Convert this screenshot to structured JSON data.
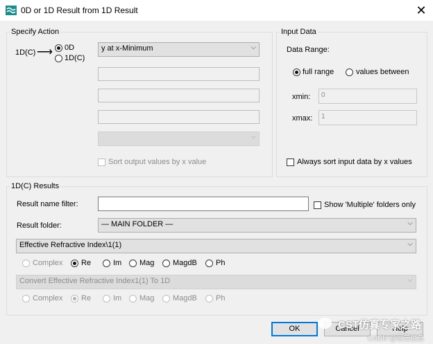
{
  "window": {
    "title": "0D or 1D Result from 1D Result",
    "app_icon": "wave-icon",
    "close_icon": "close-icon"
  },
  "specify_action": {
    "legend": "Specify Action",
    "source_label": "1D(C)",
    "options": [
      {
        "label": "0D",
        "selected": true
      },
      {
        "label": "1D(C)",
        "selected": false
      }
    ],
    "operation_value": "y at x-Minimum",
    "sort_output_label": "Sort output values by x value"
  },
  "input_data": {
    "legend": "Input Data",
    "data_range_label": "Data Range:",
    "range_options": [
      {
        "label": "full range",
        "selected": true
      },
      {
        "label": "values between",
        "selected": false
      }
    ],
    "xmin_label": "xmin:",
    "xmin_value": "0",
    "xmax_label": "xmax:",
    "xmax_value": "1",
    "always_sort_label": "Always sort input data by x values"
  },
  "results": {
    "legend": "1D(C) Results",
    "name_filter_label": "Result name filter:",
    "name_filter_value": "",
    "show_multiple_label": "Show 'Multiple' folders only",
    "folder_label": "Result folder:",
    "folder_value": "— MAIN FOLDER —",
    "result_value": "Effective Refractive Index\\1(1)",
    "components_1": [
      "Complex",
      "Re",
      "Im",
      "Mag",
      "MagdB",
      "Ph"
    ],
    "components_1_selected": "Re",
    "convert_value": "Convert Effective Refractive Index1(1) To 1D",
    "components_2": [
      "Complex",
      "Re",
      "Im",
      "Mag",
      "MagdB",
      "Ph"
    ],
    "components_2_selected": "Re"
  },
  "buttons": {
    "ok": "OK",
    "cancel": "Cancel",
    "help": "Help"
  },
  "watermark": {
    "line1": "CST仿真专家之路",
    "line2": "CSDN @思茂信息"
  }
}
